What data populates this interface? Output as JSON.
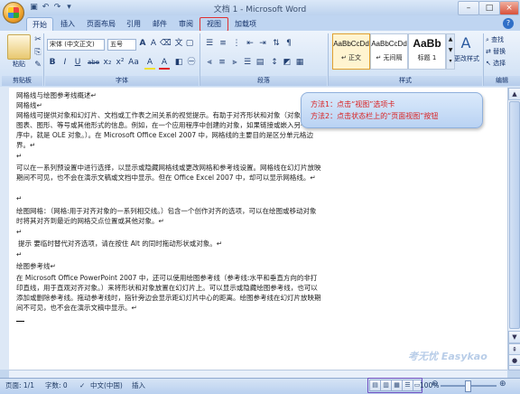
{
  "window": {
    "title": "文档 1 - Microsoft Word",
    "minimize": "–",
    "maximize": "□",
    "close": "×"
  },
  "quick_access": [
    "save-icon",
    "undo-icon",
    "redo-icon",
    "dropdown-icon"
  ],
  "tabs": [
    {
      "label": "开始",
      "active": true
    },
    {
      "label": "插入",
      "active": false
    },
    {
      "label": "页面布局",
      "active": false
    },
    {
      "label": "引用",
      "active": false
    },
    {
      "label": "邮件",
      "active": false
    },
    {
      "label": "审阅",
      "active": false
    },
    {
      "label": "视图",
      "active": false,
      "highlighted": true
    },
    {
      "label": "加载项",
      "active": false
    }
  ],
  "ribbon": {
    "clipboard": {
      "paste_label": "粘贴",
      "group_label": "剪贴板"
    },
    "font": {
      "font_name": "宋体 (中文正文)",
      "font_size": "五号",
      "group_label": "字体",
      "buttons": [
        "B",
        "I",
        "U",
        "abe",
        "x₂",
        "x²",
        "Aa",
        "A",
        "A"
      ]
    },
    "paragraph": {
      "group_label": "段落"
    },
    "styles": {
      "group_label": "样式",
      "cards": [
        {
          "sample": "AaBbCcDd",
          "name": "↵ 正文"
        },
        {
          "sample": "AaBbCcDd",
          "name": "↵ 无间隔"
        },
        {
          "sample": "AaBb",
          "name": "标题 1"
        }
      ],
      "change_styles": "更改样式"
    },
    "editing": {
      "group_label": "编辑",
      "find": "查找",
      "replace": "替换",
      "select": "选择"
    }
  },
  "callout": {
    "line1": "方法1：点击“视图”选项卡",
    "line2": "方法2：点击状态栏上的“页面视图”按钮"
  },
  "document": {
    "paragraphs": [
      "网格线与绘图参考线概述↵",
      "网格线↵",
      "网格线可提供对象和幻灯片、文档或工作表之间关系的视觉提示。有助于对齐形状和对象（对象：表、图表、图形、等号或其他形式的信息。例如，在一个应用程序中创建的对象，如果链接或嵌入另一个程序中，就是 OLE 对象。）。在 Microsoft Office Excel 2007 中，网格线的主要目的是区分单元格边界。↵",
      "↵",
      "可以在一系列预设置中进行选择，以显示或隐藏网格线或更改网格和参考线设置。网格线在幻灯片放映期间不可见，也不会在演示文稿或文档中显示。但在 Office Excel 2007 中，却可以显示网格线。↵",
      "↵",
      "绘图网格：（网格:用于对齐对象的一系列相交线。）包含一个创作对齐的选项，可以在绘图或移动对象时将其对齐到最近的网格交点位置或其他对象。↵",
      "↵",
      "提示   要临时替代对齐选项，请在按住 Alt 的同时拖动形状或对象。↵",
      "↵",
      "绘图参考线↵",
      "在 Microsoft Office PowerPoint 2007 中，还可以使用绘图参考线（参考线:水平和垂直方向的非打印直线，用于直观对齐对象。）来将形状和对象放置在幻灯片上。可以显示或隐藏绘图参考线，也可以添加或删除参考线。拖动参考线时，指针旁边会显示距幻灯片中心的距离。绘图参考线在幻灯片放映期间不可见，也不会在演示文稿中显示。↵"
    ]
  },
  "watermark": "考无忧 Easykao",
  "status": {
    "page": "页面: 1/1",
    "words": "字数: 0",
    "language": "中文(中国)",
    "mode": "插入",
    "zoom": "100%",
    "zoom_value": 1.0
  },
  "colors": {
    "highlight_box": "#e03030",
    "callout_text": "#d92020",
    "status_box": "#7050c0"
  }
}
